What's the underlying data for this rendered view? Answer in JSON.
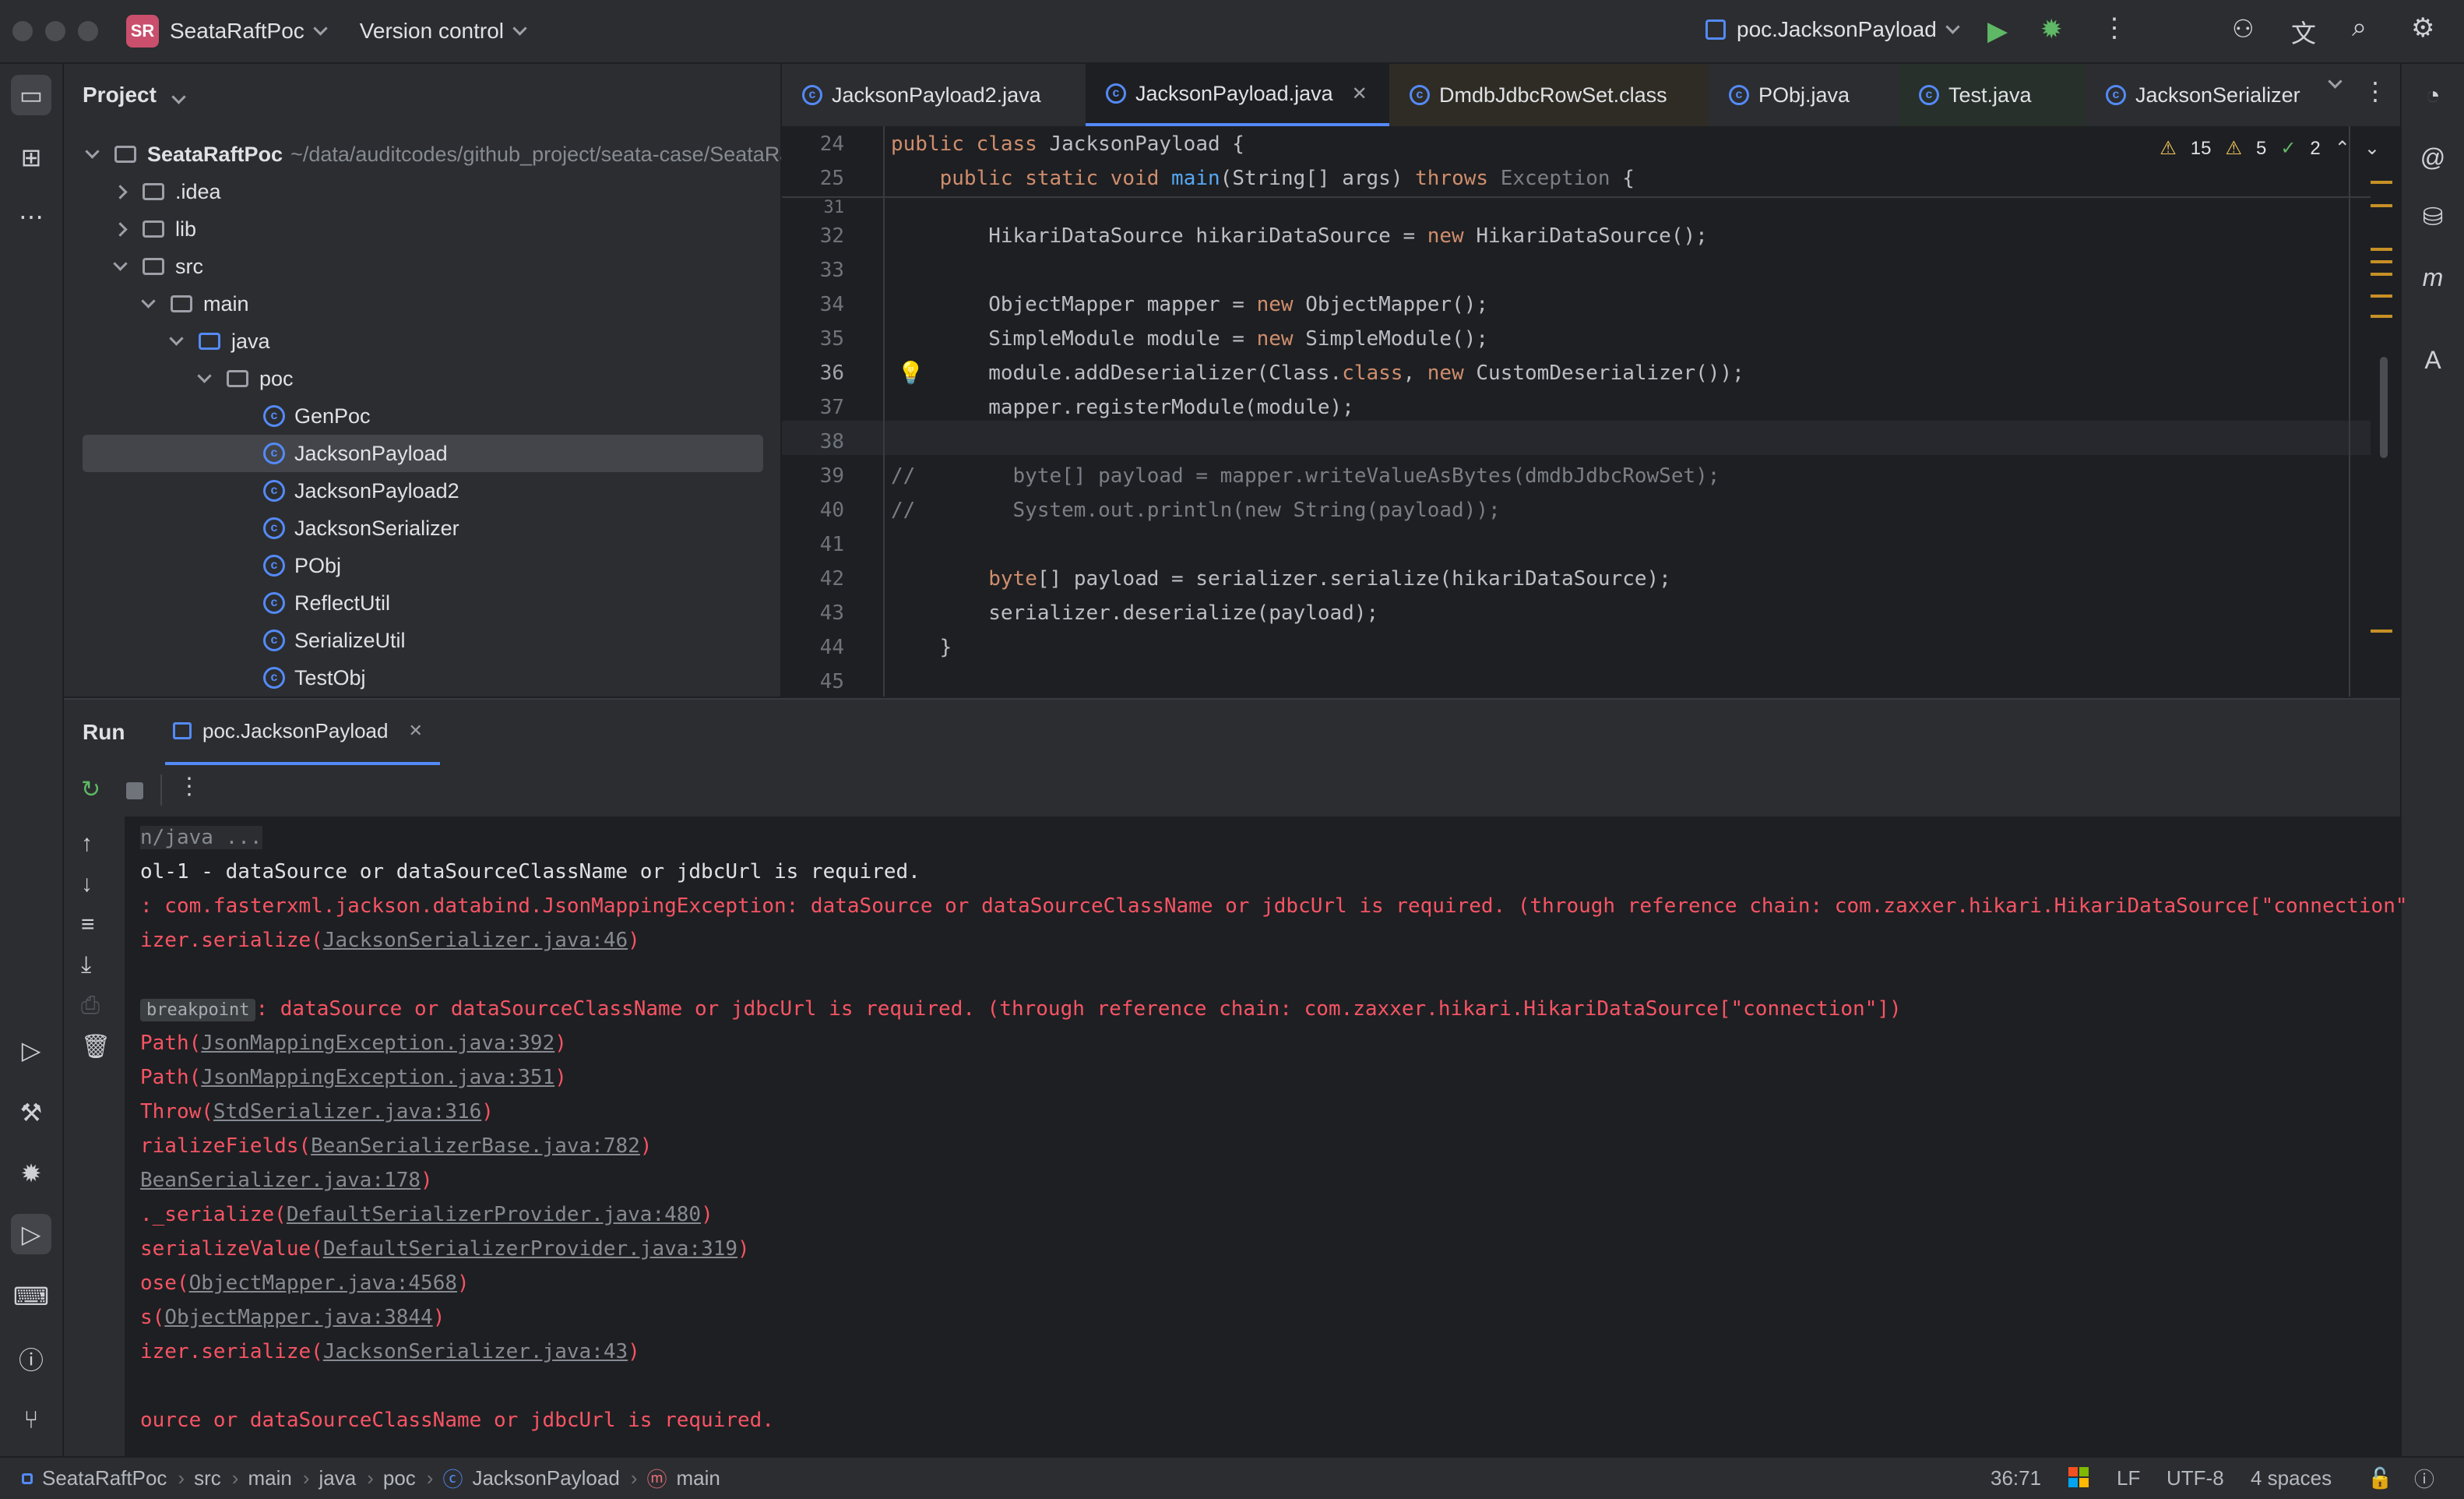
{
  "titlebar": {
    "project_badge": "SR",
    "project_name": "SeataRaftPoc",
    "vcs": "Version control",
    "run_config": "poc.JacksonPayload"
  },
  "project_panel": {
    "title": "Project",
    "root_name": "SeataRaftPoc",
    "root_path": "~/data/auditcodes/github_project/seata-case/SeataRaftPoc",
    "items": [
      {
        "label": ".idea"
      },
      {
        "label": "lib"
      },
      {
        "label": "src"
      },
      {
        "label": "main"
      },
      {
        "label": "java"
      },
      {
        "label": "poc"
      },
      {
        "label": "GenPoc"
      },
      {
        "label": "JacksonPayload"
      },
      {
        "label": "JacksonPayload2"
      },
      {
        "label": "JacksonSerializer"
      },
      {
        "label": "PObj"
      },
      {
        "label": "ReflectUtil"
      },
      {
        "label": "SerializeUtil"
      },
      {
        "label": "TestObj"
      }
    ]
  },
  "editor": {
    "tabs": [
      {
        "label": "JacksonPayload2.java"
      },
      {
        "label": "JacksonPayload.java"
      },
      {
        "label": "DmdbJdbcRowSet.class"
      },
      {
        "label": "PObj.java"
      },
      {
        "label": "Test.java"
      },
      {
        "label": "JacksonSerializer"
      }
    ],
    "inspections": {
      "warnings": "15",
      "weak": "5",
      "ok": "2"
    },
    "lines": {
      "l24": "24",
      "l25": "25",
      "l31": "31",
      "l32": "32",
      "l33": "33",
      "l34": "34",
      "l35": "35",
      "l36": "36",
      "l37": "37",
      "l38": "38",
      "l39": "39",
      "l40": "40",
      "l41": "41",
      "l42": "42",
      "l43": "43",
      "l44": "44",
      "l45": "45"
    }
  },
  "run": {
    "title": "Run",
    "tab": "poc.JacksonPayload",
    "breakpoint": "breakpoint"
  },
  "statusbar": {
    "crumbs": [
      "SeataRaftPoc",
      "src",
      "main",
      "java",
      "poc",
      "JacksonPayload",
      "main"
    ],
    "position": "36:71",
    "line_sep": "LF",
    "encoding": "UTF-8",
    "indent": "4 spaces"
  }
}
